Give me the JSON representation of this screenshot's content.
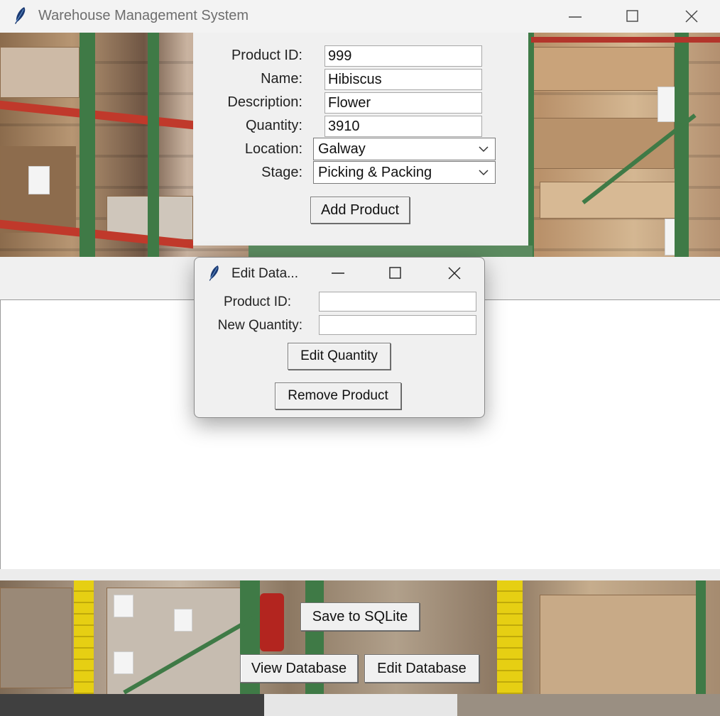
{
  "window": {
    "title": "Warehouse Management System",
    "icons": [
      "feather-icon",
      "minimize-icon",
      "maximize-icon",
      "close-icon"
    ]
  },
  "form": {
    "product_id_label": "Product ID:",
    "product_id_value": "999",
    "name_label": "Name:",
    "name_value": "Hibiscus",
    "description_label": "Description:",
    "description_value": "Flower",
    "quantity_label": "Quantity:",
    "quantity_value": "3910",
    "location_label": "Location:",
    "location_value": "Galway",
    "stage_label": "Stage:",
    "stage_value": "Picking & Packing",
    "add_button": "Add Product"
  },
  "dialog": {
    "title": "Edit Data...",
    "product_id_label": "Product ID:",
    "product_id_value": "",
    "new_quantity_label": "New Quantity:",
    "new_quantity_value": "",
    "edit_button": "Edit Quantity",
    "remove_button": "Remove Product"
  },
  "footer": {
    "save_button": "Save to SQLite",
    "view_button": "View Database",
    "edit_button": "Edit Database"
  },
  "colors": {
    "window_bg": "#f0f0f0",
    "button_border": "#7a7a7a"
  }
}
